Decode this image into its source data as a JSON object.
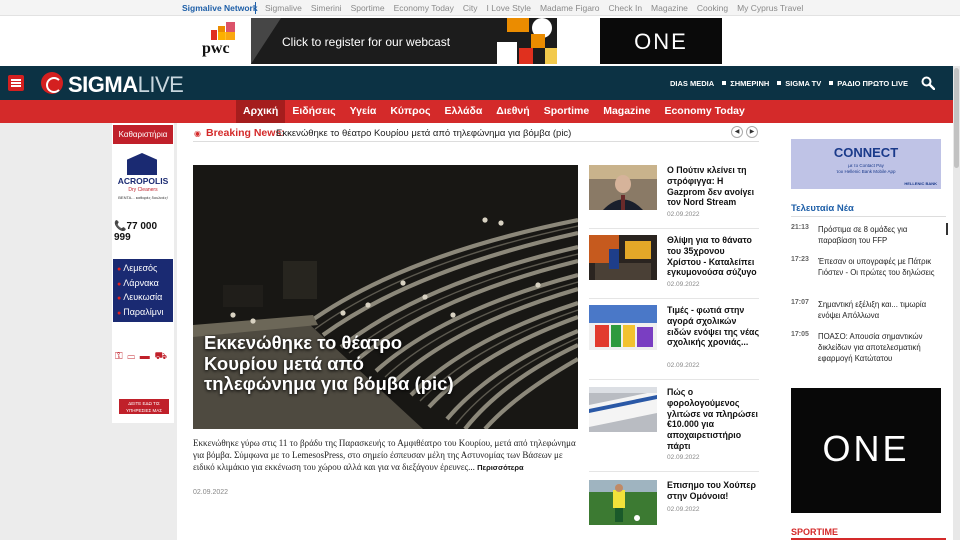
{
  "network": {
    "brand": "Sigmalive Network",
    "links": [
      "Sigmalive",
      "Simerini",
      "Sportime",
      "Economy Today",
      "City",
      "I Love Style",
      "Madame Figaro",
      "Check In",
      "Magazine",
      "Cooking",
      "My Cyprus Travel"
    ]
  },
  "top_ads": {
    "pwc_logo": "pwc",
    "pwc_cta": "Click to register for our webcast",
    "one_logo": "ONE"
  },
  "header": {
    "logo_sigma": "SIGMA",
    "logo_live": "LIVE",
    "links": [
      "DIAS MEDIA",
      "ΣΗΜΕΡΙΝΗ",
      "SIGMA TV",
      "ΡΑΔΙΟ ΠΡΩΤΟ LIVE"
    ],
    "accent_color": "#d42a2a",
    "header_color": "#0c3244"
  },
  "nav": {
    "items": [
      "Αρχική",
      "Ειδήσεις",
      "Υγεία",
      "Κύπρος",
      "Ελλάδα",
      "Διεθνή",
      "Sportime",
      "Magazine",
      "Economy Today"
    ],
    "active": "Αρχική"
  },
  "left_ads": {
    "title": "Καθαριστήρια",
    "brand": "ACROPOLIS",
    "brand_sub": "Dry Cleaners",
    "brand_tag": "ΒΕΝΤΑ... καθαρές δουλειές!",
    "phone": "77 000 999",
    "cities": [
      "Λεμεσός",
      "Λάρνακα",
      "Λευκωσία",
      "Παραλίμνι"
    ],
    "services_btn": "ΔΕΙΤΕ ΕΔΩ ΤΙΣ ΥΠΗΡΕΣΙΕΣ ΜΑΣ"
  },
  "breaking": {
    "label": "Breaking News:",
    "text": "Εκκενώθηκε το θέατρο Κουρίου μετά από τηλεφώνημα για βόμβα (pic)"
  },
  "hero": {
    "title": "Εκκενώθηκε το θέατρο Κουρίου μετά από τηλεφώνημα για βόμβα (pic)",
    "summary": "Εκκενώθηκε γύρω στις 11 το βράδυ της Παρασκευής το Αμφιθέατρο του Κουρίου, μετά από τηλεφώνημα για βόμβα. Σύμφωνα με το LemesosPress, στο σημείο έσπευσαν μέλη της Αστυνομίας των Βάσεων με ειδικό κλιμάκιο για εκκένωση του χώρου αλλά και για να διεξάγουν έρευνες...",
    "more": "Περισσότερα",
    "date": "02.09.2022"
  },
  "stories": [
    {
      "title": "Ο Πούτιν κλείνει τη στρόφιγγα: Η Gazprom δεν ανοίγει τον Nord Stream",
      "date": "02.09.2022"
    },
    {
      "title": "Θλίψη για το θάνατο του 35χρονου Χρίστου - Καταλείπει εγκυμονούσα σύζυγο",
      "date": "02.09.2022"
    },
    {
      "title": "Τιμές - φωτιά στην αγορά σχολικών ειδών ενόψει της νέας σχολικής χρονιάς...",
      "date": "02.09.2022"
    },
    {
      "title": "Πώς ο φορολογούμενος γλιτώσε να πληρώσει €10.000 για αποχαιρετιστήριο πάρτι",
      "date": "02.09.2022"
    },
    {
      "title": "Επισημο του Χούπερ στην Ομόνοια!",
      "date": "02.09.2022"
    }
  ],
  "right": {
    "connect_title": "CONNECT",
    "connect_line1": "με το Contact Pay",
    "connect_line2": "του Hellenic Bank Mobile App",
    "connect_bank": "HELLENIC BANK",
    "latest_title": "Τελευταία Νέα",
    "latest": [
      {
        "time": "21:13",
        "text": "Πρόστιμα σε 8 ομάδες για παραβίαση του FFP"
      },
      {
        "time": "17:23",
        "text": "Έπεσαν οι υπογραφές με Πάτρικ Γιόστεν - Οι πρώτες του δηλώσεις"
      },
      {
        "time": "17:07",
        "text": "Σημαντική εξέλιξη και... τιμωρία ενόψει Απόλλωνα"
      },
      {
        "time": "17:05",
        "text": "ΠΟΑΣΟ: Απουσία σημαντικών δικλείδων για αποτελεσματική εφαρμογή Κατώτατου"
      }
    ],
    "one_logo": "ONE",
    "sportime": "SPORTIME"
  }
}
